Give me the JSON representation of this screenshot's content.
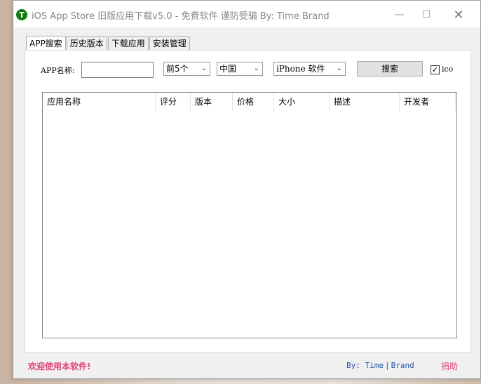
{
  "window": {
    "title": "iOS App Store 旧版应用下载v5.0 - 免费软件 谨防受骗 By: Time Brand",
    "app_icon_glyph": "T",
    "minimize_glyph": "—",
    "maximize_glyph": "☐",
    "close_glyph": "✕"
  },
  "tabs": [
    {
      "label": "APP搜索",
      "active": true
    },
    {
      "label": "历史版本"
    },
    {
      "label": "下载应用"
    },
    {
      "label": "安装管理"
    }
  ],
  "search": {
    "app_name_label": "APP名称:",
    "app_name_value": "",
    "top_select": "前5个",
    "country_select": "中国",
    "type_select": "iPhone 软件",
    "search_button": "搜索",
    "ico_checked": true,
    "ico_check_glyph": "✓",
    "ico_label": "ico"
  },
  "table": {
    "columns": [
      "应用名称",
      "评分",
      "版本",
      "价格",
      "大小",
      "描述",
      "开发者"
    ],
    "rows": []
  },
  "status": {
    "welcome": "欢迎使用本软件!",
    "by_prefix": "By: Time",
    "by_suffix": "Brand",
    "separator": "|",
    "donate": "捐助"
  },
  "colors": {
    "accent_pink": "#e0457a",
    "link_blue": "#2a57a6",
    "icon_green": "#0f7b0f"
  }
}
